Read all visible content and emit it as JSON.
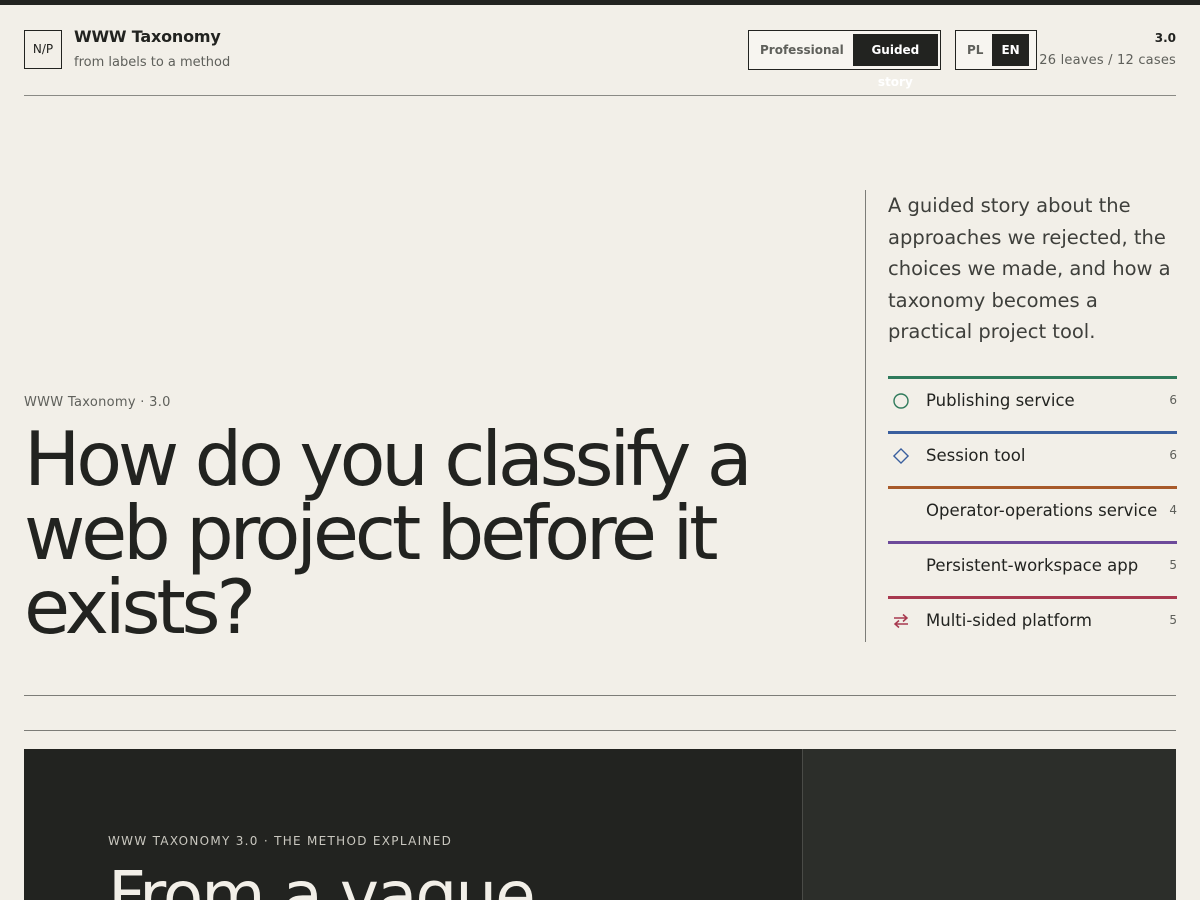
{
  "header": {
    "logo": "N/P",
    "title": "WWW Taxonomy",
    "subtitle": "from labels to a method",
    "mode_options": [
      {
        "label": "Professional",
        "active": false
      },
      {
        "label": "Guided story",
        "active": true
      }
    ],
    "lang_options": [
      {
        "label": "PL",
        "active": false
      },
      {
        "label": "EN",
        "active": true
      }
    ],
    "version": "3.0",
    "stats": "26 leaves / 12 cases"
  },
  "hero": {
    "eyebrow": "WWW Taxonomy · 3.0",
    "title": "How do you classify a web project before it exists?",
    "description": "A guided story about the approaches we rejected, the choices we made, and how a taxonomy becomes a practical project tool.",
    "categories": [
      {
        "label": "Publishing service",
        "count": "6",
        "color": "#2f7a5b",
        "icon": "circle-icon"
      },
      {
        "label": "Session tool",
        "count": "6",
        "color": "#3a5f9e",
        "icon": "diamond-icon"
      },
      {
        "label": "Operator-operations service",
        "count": "4",
        "color": "#a85a2a",
        "icon": ""
      },
      {
        "label": "Persistent-workspace app",
        "count": "5",
        "color": "#6d4a9a",
        "icon": ""
      },
      {
        "label": "Multi-sided platform",
        "count": "5",
        "color": "#a8394f",
        "icon": "swap-arrows-icon"
      }
    ]
  },
  "section": {
    "eyebrow": "WWW TAXONOMY 3.0 · THE METHOD EXPLAINED",
    "title": "From a vague"
  }
}
